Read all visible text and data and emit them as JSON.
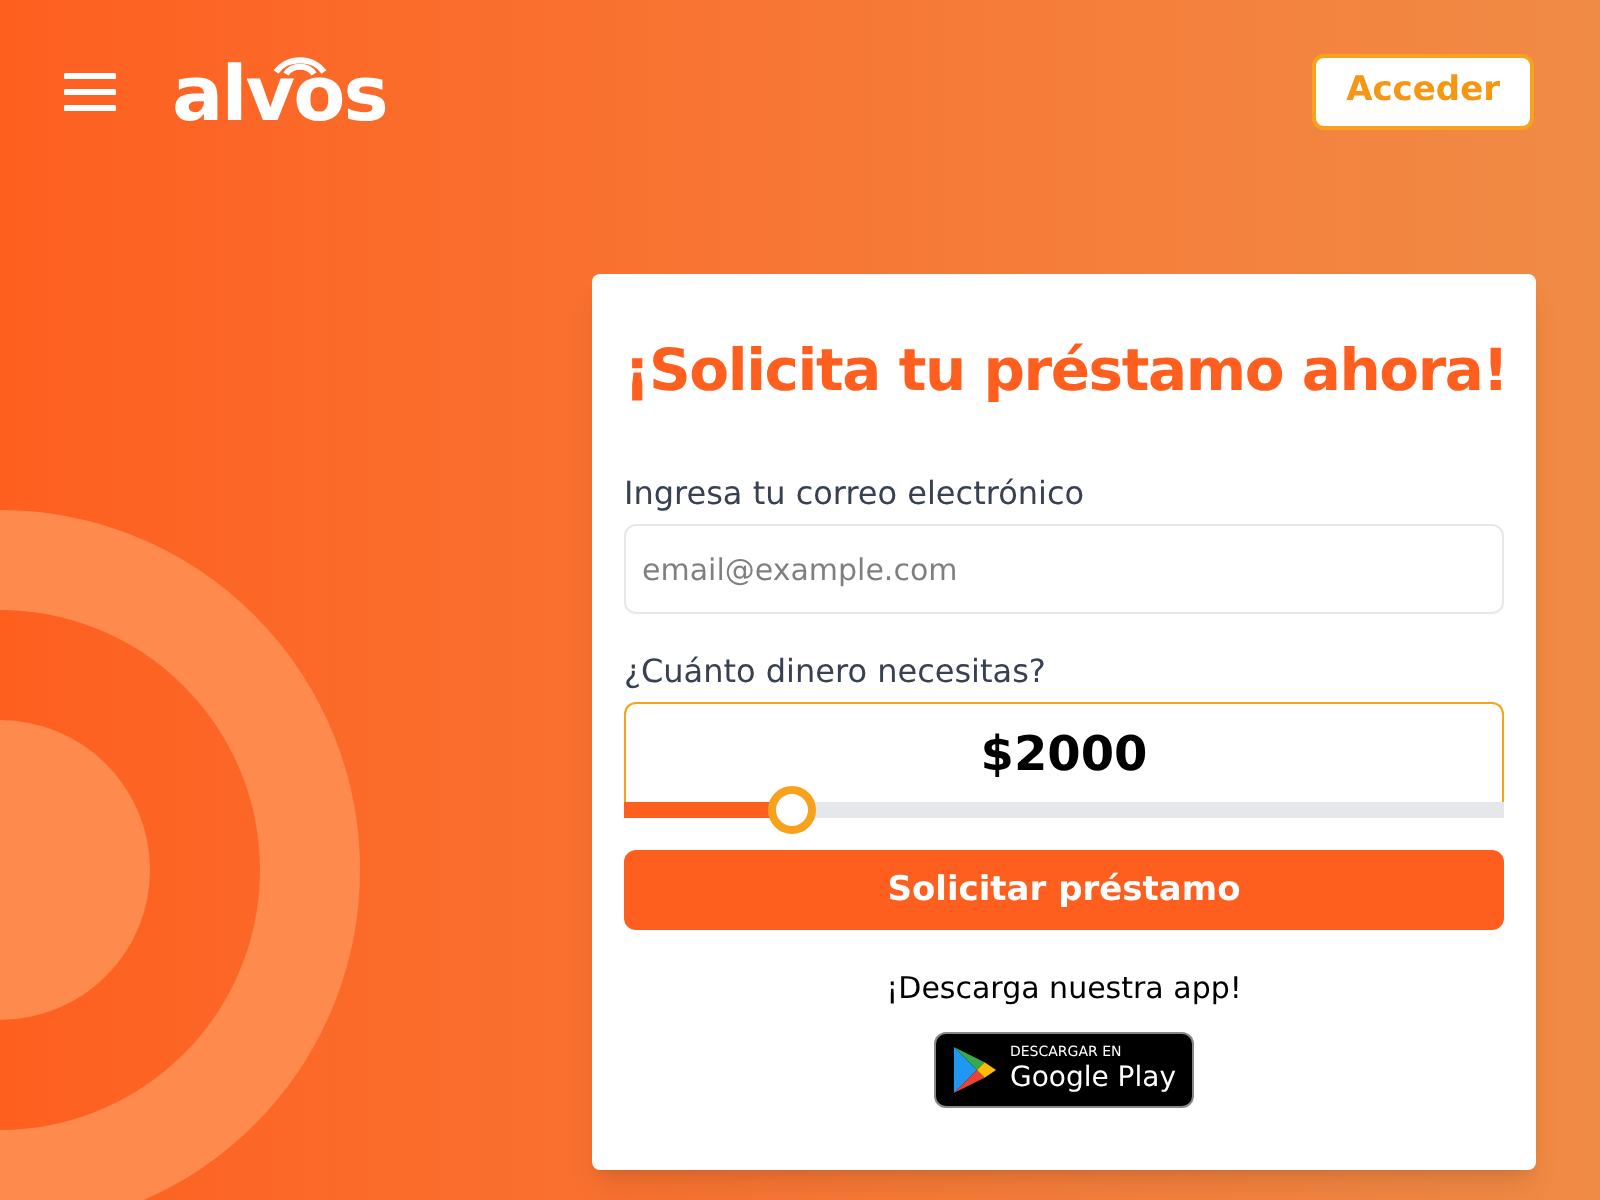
{
  "header": {
    "logo": "alvos",
    "login_button": "Acceder"
  },
  "form": {
    "title": "¡Solicita tu préstamo ahora!",
    "email": {
      "label": "Ingresa tu correo electrónico",
      "placeholder": "email@example.com"
    },
    "amount": {
      "label": "¿Cuánto dinero necesitas?",
      "value": "$2000",
      "level": 0.19
    },
    "submit_button": "Solicitar préstamo",
    "download_text": "¡Descarga nuestra app!",
    "store_badge": {
      "caption": "DESCARGAR EN",
      "store": "Google Play"
    }
  }
}
